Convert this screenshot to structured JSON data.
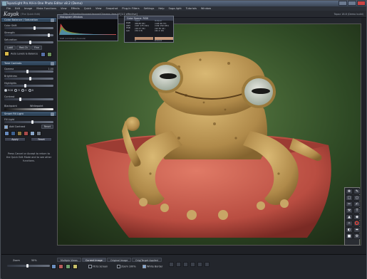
{
  "window": {
    "title": "TopazLight Pro All-in-One Photo Editor v8.2 (Demo)",
    "controls": [
      "minimize",
      "maximize",
      "close"
    ]
  },
  "menu": [
    "File",
    "Edit",
    "Image",
    "Make Functions",
    "View",
    "Effects",
    "Quick",
    "View",
    "Snapshot",
    "Plug-In Filters",
    "Settings",
    "Help",
    "Saga-light",
    "Tutorials",
    "Window"
  ],
  "brand": {
    "logo": "Kayak",
    "sub": "(The Quick Edit)"
  },
  "file_path": "File: C:\\Rundoc\\Images\\ImageA2\\green_frog.tif [1:2 effective]",
  "version": "Topaz 18.8 (Demo build)",
  "left_panel": {
    "sec1": "Color Balance / Saturation",
    "rows1": [
      "Color Shift",
      "Strength",
      "Saturation"
    ],
    "chips1": [
      "Lab8",
      "Red-Ch",
      "Fine"
    ],
    "auto_levels": "Auto Levels & Balance",
    "sec2": "Tone Controls",
    "rows2": [
      "Gamma",
      "Brightness",
      "Highlights"
    ],
    "gamma_val": "1.00",
    "radios": [
      "RGB",
      "R",
      "G",
      "B"
    ],
    "contrast": "Contrast",
    "blackpoint": "Blackpoint",
    "whitepoint": "Whitepoint",
    "sec3": "Smart Fill Light",
    "fill_light": "Fill Light",
    "add_contrast": "Add Contrast",
    "add_contrast_btn": "Reset",
    "apply": "Apply",
    "reset": "Reset",
    "help_text": "Press Cancel or Accept to return to the Quick Edit Mode and to see other functions."
  },
  "histogram": {
    "title": "Histogram Window",
    "footer": "RGB (combined channels)"
  },
  "color_space": {
    "title": "Color Space: RGB",
    "col_labels": [
      "RGB",
      "CMY",
      "HSB",
      "Lab"
    ],
    "input": {
      "label": "Input",
      "values": [
        "(88 80 64)",
        "(167 175 191)",
        "(40 27 34)",
        "(34 1 8)"
      ]
    },
    "output": {
      "label": "Output",
      "values": [
        "(106 96 74)",
        "(149 159 181)",
        "(42 30 41)",
        "(41 2 10)"
      ]
    },
    "footer_left": "0",
    "footer_right": "0 0 0 0"
  },
  "bottom": {
    "zoom_label": "Zoom",
    "zoom_value": "50%",
    "tabs": [
      "Multiple Views",
      "Current Image",
      "Original Image",
      "Orig/Target Applied"
    ],
    "fit_to_screen": "Fit to Screen",
    "zoom100": "Zoom 100%",
    "white_border": "White Border"
  },
  "tools": [
    "✥",
    "✎",
    "□",
    "○",
    "✂",
    "✍",
    "⚒",
    "T",
    "▲",
    "◆",
    "✧",
    "⭕",
    "◐",
    "⬌",
    "■",
    "⚙"
  ],
  "colors": {
    "accent": "#3c5670",
    "background": "#1f2126",
    "frog": "#b9954e"
  }
}
